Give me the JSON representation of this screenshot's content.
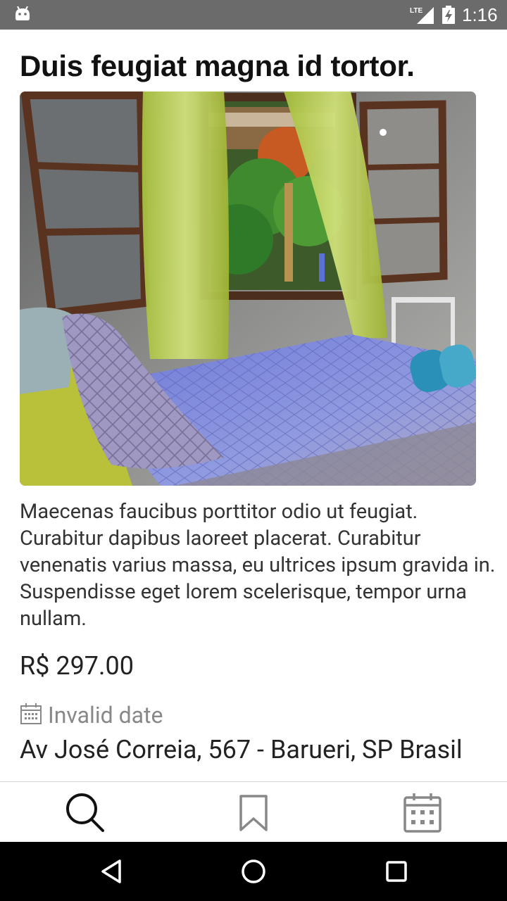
{
  "status_bar": {
    "time": "1:16",
    "network": "LTE",
    "icons": [
      "android-icon",
      "lte-signal-icon",
      "battery-charging-icon"
    ]
  },
  "listing": {
    "title": "Duis feugiat magna id tortor.",
    "image_alt": "bedroom-photo",
    "description": "Maecenas faucibus porttitor odio ut feugiat. Curabitur dapibus laoreet placerat. Curabitur venenatis varius massa, eu ultrices ipsum gravida in. Suspendisse eget lorem scelerisque, tempor urna nullam.",
    "price": "R$ 297.00",
    "date": "Invalid date",
    "address": "Av José Correia, 567 - Barueri, SP Brasil"
  },
  "bottom_nav": {
    "items": [
      {
        "name": "search",
        "icon": "search-icon"
      },
      {
        "name": "saved",
        "icon": "bookmark-icon"
      },
      {
        "name": "calendar",
        "icon": "calendar-icon"
      }
    ]
  },
  "system_nav": {
    "items": [
      "back-icon",
      "home-icon",
      "recents-icon"
    ]
  },
  "colors": {
    "status_bar": "#6b6b6b",
    "text_primary": "#222222",
    "text_secondary": "#888888",
    "system_nav": "#000000"
  }
}
